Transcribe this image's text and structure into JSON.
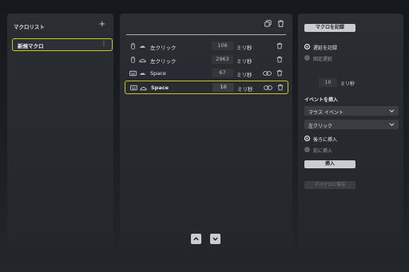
{
  "left_panel": {
    "title": "マクロリスト",
    "add_icon": "plus-icon",
    "macros": [
      {
        "name": "新規マクロ",
        "selected": true
      }
    ]
  },
  "middle_panel": {
    "toolbar_icons": [
      "copy-icon",
      "trash-icon"
    ],
    "rows": [
      {
        "device": "mouse",
        "direction": "down",
        "action": "左クリック",
        "delay": "106",
        "unit": "ミリ秒",
        "link": false,
        "selected": false
      },
      {
        "device": "mouse",
        "direction": "up",
        "action": "左クリック",
        "delay": "2963",
        "unit": "ミリ秒",
        "link": false,
        "selected": false
      },
      {
        "device": "keyboard",
        "direction": "down",
        "action": "Space",
        "delay": "67",
        "unit": "ミリ秒",
        "link": true,
        "selected": false
      },
      {
        "device": "keyboard",
        "direction": "up",
        "action": "Space",
        "delay": "10",
        "unit": "ミリ秒",
        "link": true,
        "selected": true
      }
    ],
    "move_buttons": [
      "move-up-icon",
      "move-down-icon"
    ]
  },
  "right_panel": {
    "record_button": "マクロを記録",
    "record_delay_label": "遅延を記録",
    "fixed_delay_label": "固定遅延",
    "fixed_delay_value": "10",
    "fixed_delay_unit": "ミリ秒",
    "insert_event_title": "イベントを挿入",
    "event_type_select": "マウス イベント",
    "event_select": "左クリック",
    "insert_after_label": "後ろに挿入",
    "insert_before_label": "前に挿入",
    "insert_button": "挿入",
    "save_button": "デバイスに保存"
  },
  "colors": {
    "accent": "#c8c420",
    "panel": "#2a2e33",
    "button": "#c9ccd0"
  }
}
